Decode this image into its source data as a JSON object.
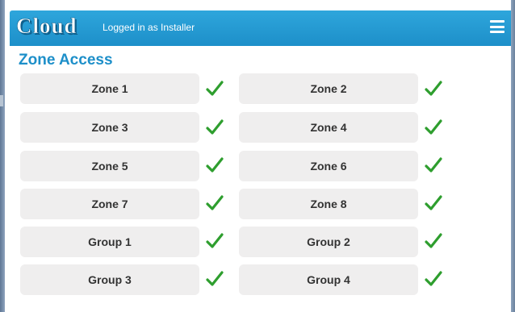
{
  "header": {
    "logo": "Cloud",
    "login_text": "Logged in as Installer"
  },
  "page_title": "Zone Access",
  "zones": [
    {
      "label": "Zone 1",
      "access": true
    },
    {
      "label": "Zone 2",
      "access": true
    },
    {
      "label": "Zone 3",
      "access": true
    },
    {
      "label": "Zone 4",
      "access": true
    },
    {
      "label": "Zone 5",
      "access": true
    },
    {
      "label": "Zone 6",
      "access": true
    },
    {
      "label": "Zone 7",
      "access": true
    },
    {
      "label": "Zone 8",
      "access": true
    },
    {
      "label": "Group 1",
      "access": true
    },
    {
      "label": "Group 2",
      "access": true
    },
    {
      "label": "Group 3",
      "access": true
    },
    {
      "label": "Group 4",
      "access": true
    }
  ],
  "colors": {
    "header": "#2ea6dc",
    "title": "#1d8fc9",
    "check": "#2e9e2e",
    "tile": "#efeeee"
  }
}
